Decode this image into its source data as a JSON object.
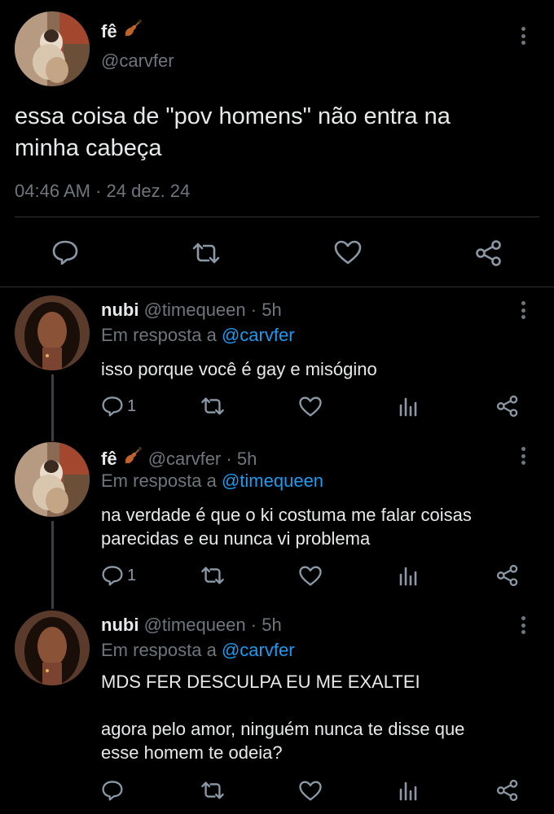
{
  "main_tweet": {
    "display_name": "fê",
    "handle": "@carvfer",
    "text_line1": "essa coisa de \"pov homens\" não entra na",
    "text_line2": "minha cabeça",
    "time": "04:46 AM",
    "separator": "·",
    "date": "24 dez. 24"
  },
  "replies": [
    {
      "display_name": "nubi",
      "handle": "@timequeen",
      "age": "· 5h",
      "reply_prefix": "Em resposta a",
      "reply_to": "@carvfer",
      "text_lines": [
        "isso porque você é gay e misógino"
      ],
      "reply_count": "1"
    },
    {
      "display_name": "fê",
      "handle": "@carvfer",
      "age": "· 5h",
      "reply_prefix": "Em resposta a",
      "reply_to": "@timequeen",
      "text_lines": [
        "na verdade é que o ki costuma me falar coisas",
        "parecidas e eu nunca vi problema"
      ],
      "reply_count": "1"
    },
    {
      "display_name": "nubi",
      "handle": "@timequeen",
      "age": "· 5h",
      "reply_prefix": "Em resposta a",
      "reply_to": "@carvfer",
      "text_lines": [
        "MDS FER DESCULPA EU ME EXALTEI",
        "agora pelo amor, ninguém nunca te disse que",
        "esse homem te odeia?"
      ],
      "reply_count": ""
    }
  ],
  "icons": {
    "reply": "speech-bubble-icon",
    "retweet": "retweet-icon",
    "like": "heart-icon",
    "share": "share-icon",
    "analytics": "analytics-icon",
    "more": "vertical-dots-icon",
    "emoji": "violin-emoji"
  },
  "colors": {
    "background": "#000000",
    "text": "#e7e9ea",
    "muted": "#6e767d",
    "link": "#1d9bf0",
    "divider": "#2f3336"
  }
}
